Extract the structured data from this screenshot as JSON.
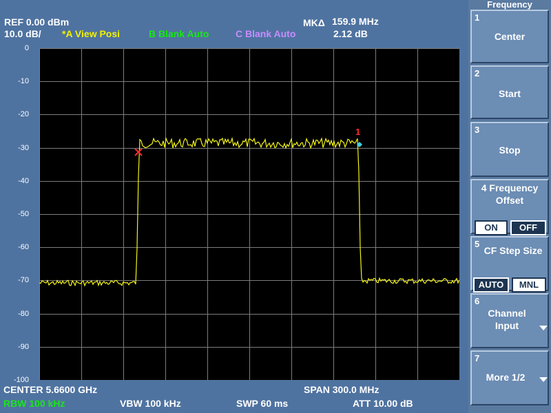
{
  "header": {
    "ref": "REF  0.00 dBm",
    "scale": "10.0 dB/",
    "trace_a": "*A View Posi",
    "trace_b": "B Blank Auto",
    "trace_c": "C Blank Auto",
    "marker_label": "MKΔ",
    "marker_freq": "159.9 MHz",
    "marker_amp": "2.12 dB"
  },
  "colors": {
    "trace_a": "#f2f200",
    "trace_b": "#19e619",
    "trace_c": "#c78cff",
    "trace": "#f4f41a",
    "marker_x": "#ff2a2a",
    "marker_diamond": "#3fd0e8",
    "marker_num": "#ff2a2a"
  },
  "plot": {
    "y_labels": [
      "0",
      "-10",
      "-20",
      "-30",
      "-40",
      "-50",
      "-60",
      "-70",
      "-80",
      "-90",
      "-100"
    ],
    "marker_num": "1"
  },
  "footer": {
    "center": "CENTER 5.6600 GHz",
    "span": "SPAN 300.0 MHz",
    "rbw": "RBW  100 kHz",
    "vbw": "VBW  100 kHz",
    "swp": "SWP  60 ms",
    "att": "ATT 10.00 dB"
  },
  "softkeys": {
    "title": "Frequency",
    "keys": [
      {
        "num": "1",
        "label": "Center"
      },
      {
        "num": "2",
        "label": "Start"
      },
      {
        "num": "3",
        "label": "Stop"
      },
      {
        "num": "4",
        "label_line1": "4 Frequency",
        "label_line2": "Offset",
        "on": "ON",
        "off": "OFF"
      },
      {
        "num": "5",
        "label": "CF Step Size",
        "auto": "AUTO",
        "mnl": "MNL"
      },
      {
        "num": "6",
        "label_line1": "Channel",
        "label_line2": "Input"
      },
      {
        "num": "7",
        "label": "More 1/2"
      }
    ]
  }
}
